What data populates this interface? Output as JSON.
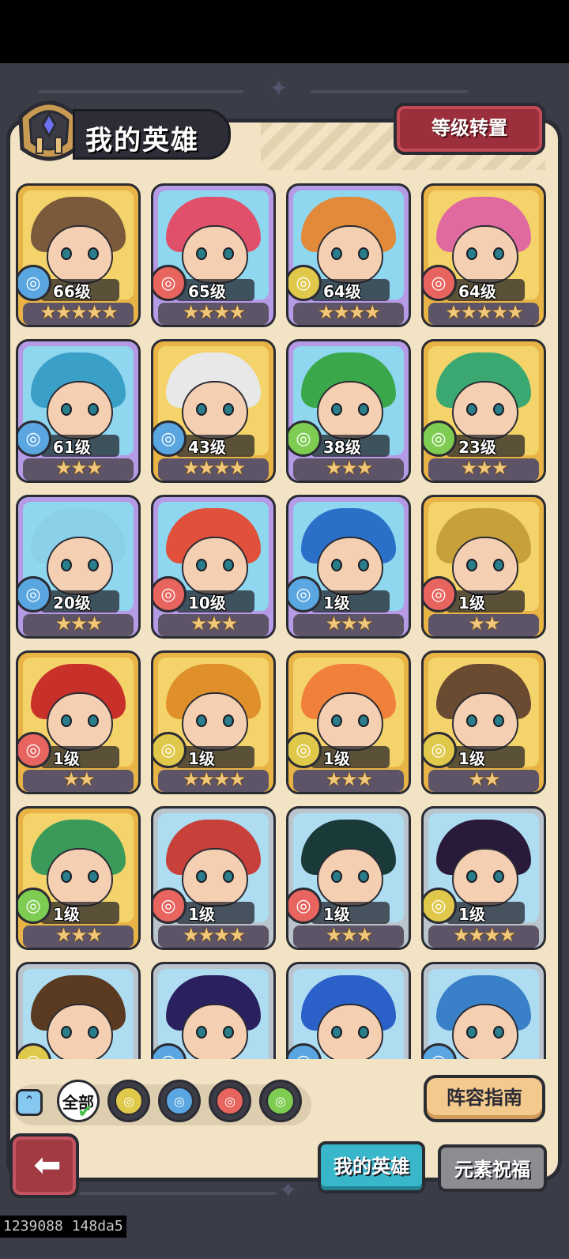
{
  "title": "我的英雄",
  "level_reset_label": "等级转置",
  "heroes": [
    {
      "level": "66级",
      "element": "water",
      "stars": "★★★★★",
      "frame": "gold",
      "hair": "#7a5a3a"
    },
    {
      "level": "65级",
      "element": "fire",
      "stars": "★★★★",
      "frame": "purple",
      "hair": "#e0506a"
    },
    {
      "level": "64级",
      "element": "earth",
      "stars": "★★★★",
      "frame": "purple",
      "hair": "#e08a3a"
    },
    {
      "level": "64级",
      "element": "fire",
      "stars": "★★★★★",
      "frame": "gold",
      "hair": "#e06aa0"
    },
    {
      "level": "61级",
      "element": "water",
      "stars": "★★★",
      "frame": "purple",
      "hair": "#3aa0c8"
    },
    {
      "level": "43级",
      "element": "water",
      "stars": "★★★★",
      "frame": "gold",
      "hair": "#e8e8e8"
    },
    {
      "level": "38级",
      "element": "wind",
      "stars": "★★★",
      "frame": "purple",
      "hair": "#3aa84a"
    },
    {
      "level": "23级",
      "element": "wind",
      "stars": "★★★",
      "frame": "gold",
      "hair": "#3aa870"
    },
    {
      "level": "20级",
      "element": "water",
      "stars": "★★★",
      "frame": "purple",
      "hair": "#8ad0e8"
    },
    {
      "level": "10级",
      "element": "fire",
      "stars": "★★★",
      "frame": "purple",
      "hair": "#e0503a"
    },
    {
      "level": "1级",
      "element": "water",
      "stars": "★★★",
      "frame": "purple",
      "hair": "#2a70c8"
    },
    {
      "level": "1级",
      "element": "fire",
      "stars": "★★",
      "frame": "gold",
      "hair": "#c8a03a"
    },
    {
      "level": "1级",
      "element": "fire",
      "stars": "★★",
      "frame": "gold",
      "hair": "#c8302a"
    },
    {
      "level": "1级",
      "element": "earth",
      "stars": "★★★★",
      "frame": "gold",
      "hair": "#e0902a"
    },
    {
      "level": "1级",
      "element": "earth",
      "stars": "★★★",
      "frame": "gold",
      "hair": "#f0803a"
    },
    {
      "level": "1级",
      "element": "earth",
      "stars": "★★",
      "frame": "gold",
      "hair": "#6a4a30"
    },
    {
      "level": "1级",
      "element": "wind",
      "stars": "★★★",
      "frame": "gold",
      "hair": "#3a9a5a"
    },
    {
      "level": "1级",
      "element": "fire",
      "stars": "★★★★",
      "frame": "silver",
      "hair": "#c8403a"
    },
    {
      "level": "1级",
      "element": "fire",
      "stars": "★★★",
      "frame": "silver",
      "hair": "#1a3a3a"
    },
    {
      "level": "1级",
      "element": "earth",
      "stars": "★★★★",
      "frame": "silver",
      "hair": "#2a1a3a"
    },
    {
      "level": "",
      "element": "earth",
      "stars": "",
      "frame": "silver",
      "hair": "#5a3a20"
    },
    {
      "level": "",
      "element": "water",
      "stars": "",
      "frame": "silver",
      "hair": "#2a2060"
    },
    {
      "level": "",
      "element": "water",
      "stars": "",
      "frame": "silver",
      "hair": "#2a60c8"
    },
    {
      "level": "",
      "element": "water",
      "stars": "",
      "frame": "silver",
      "hair": "#3a80c8"
    }
  ],
  "filters": {
    "all_label": "全部",
    "icons": [
      "earth-icon",
      "water-icon",
      "fire-icon",
      "wind-icon"
    ]
  },
  "lineup_guide_label": "阵容指南",
  "tabs": {
    "my_heroes": "我的英雄",
    "element_blessing": "元素祝福"
  },
  "debug_text": "1239088 148da5",
  "colors": {
    "water": "#5aa6e0",
    "fire": "#e8645f",
    "earth": "#e0c84a",
    "wind": "#7ecc52",
    "frame_gold": "#e9b446",
    "frame_purple": "#b59ae6",
    "frame_silver": "#b9c4cc"
  }
}
